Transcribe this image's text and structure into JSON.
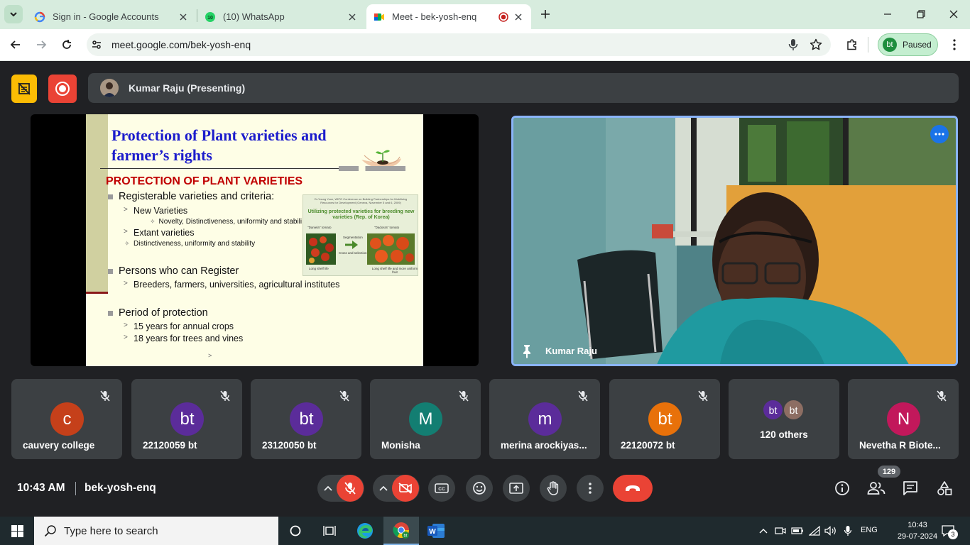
{
  "browser": {
    "tabs": [
      {
        "title": "Sign in - Google Accounts",
        "state": "inactive",
        "icon": "google-g-icon"
      },
      {
        "title": "(10) WhatsApp",
        "state": "inactive",
        "icon": "whatsapp-icon",
        "badge": "10"
      },
      {
        "title": "Meet - bek-yosh-enq",
        "state": "active",
        "icon": "meet-icon"
      }
    ],
    "address": "meet.google.com/bek-yosh-enq",
    "profile": {
      "initials": "bt",
      "label": "Paused"
    }
  },
  "meet": {
    "presenter_label": "Kumar Raju (Presenting)",
    "slide": {
      "title": "Protection of Plant varieties and farmer’s rights",
      "heading": "PROTECTION OF PLANT VARIETIES",
      "bullet_1": "Registerable varieties and criteria:",
      "sub_1a": "New Varieties",
      "sub_1a_detail": "Novelty, Distinctiveness, uniformity and stabili",
      "sub_1b": "Extant varieties",
      "sub_1b_detail": "Distinctiveness, uniformity and stability",
      "bullet_2": "Persons who can Register",
      "sub_2a": "Breeders, farmers, universities, agricultural institutes",
      "bullet_3": "Period of protection",
      "sub_3a": "15 years for annual crops",
      "sub_3b": "18 years for trees and vines",
      "inset": {
        "citation": "Dr.Young Yoon, WIPO Conference on Building Partnerships for Mobilizing Resources for Development (Geneva, November 5 and 6, 2009)",
        "title": "Utilizing protected varieties for breeding new varieties (Rep. of Korea)",
        "left_label": "\"Daniela\" tomato",
        "right_label": "\"Dadosra\" tomato",
        "arrow_label": "Segmentation",
        "cross_label": "Cross and selection",
        "left_caption": "Long shelf life",
        "right_caption": "Long shelf life and more uniform fruit"
      },
      "footer_mark": ">"
    },
    "camera": {
      "name": "Kumar Raju"
    },
    "participants": [
      {
        "initial": "c",
        "name": "cauvery college",
        "color": "#c5401a"
      },
      {
        "initial": "bt",
        "name": "22120059 bt",
        "color": "#5b2c9a"
      },
      {
        "initial": "bt",
        "name": "23120050 bt",
        "color": "#5b2c9a"
      },
      {
        "initial": "M",
        "name": "Monisha",
        "color": "#137e72"
      },
      {
        "initial": "m",
        "name": "merina arockiyas...",
        "color": "#5b2c9a"
      },
      {
        "initial": "bt",
        "name": "22120072 bt",
        "color": "#e8710a"
      },
      {
        "initial": "N",
        "name": "Nevetha R Biote...",
        "color": "#c2185b"
      }
    ],
    "others": {
      "label": "120 others",
      "avatars": [
        {
          "initial": "bt",
          "color": "#5b2c9a"
        },
        {
          "initial": "bt",
          "color": "#8d6e63"
        }
      ]
    },
    "bottom": {
      "time": "10:43 AM",
      "meeting_code": "bek-yosh-enq",
      "participant_count": "129"
    }
  },
  "taskbar": {
    "search_placeholder": "Type here to search",
    "language": "ENG",
    "time": "10:43",
    "date": "29-07-2024",
    "notification_count": "3"
  }
}
